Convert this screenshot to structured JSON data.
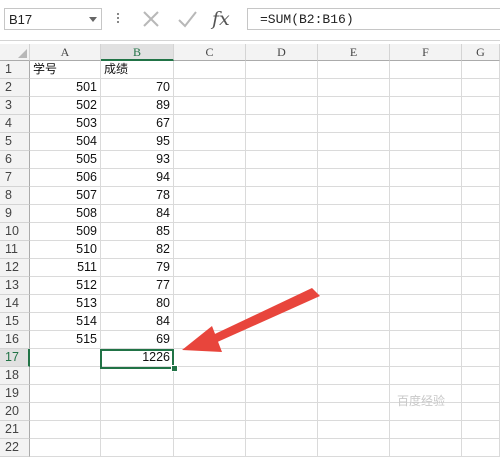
{
  "name_box": {
    "value": "B17"
  },
  "formula_bar": {
    "fx_label": "fx",
    "formula": "=SUM(B2:B16)"
  },
  "columns": [
    "A",
    "B",
    "C",
    "D",
    "E",
    "F",
    "G"
  ],
  "row_numbers": [
    "1",
    "2",
    "3",
    "4",
    "5",
    "6",
    "7",
    "8",
    "9",
    "10",
    "11",
    "12",
    "13",
    "14",
    "15",
    "16",
    "17",
    "18",
    "19",
    "20",
    "21",
    "22"
  ],
  "header_row": {
    "a": "学号",
    "b": "成绩"
  },
  "rows": [
    {
      "a": "501",
      "b": "70"
    },
    {
      "a": "502",
      "b": "89"
    },
    {
      "a": "503",
      "b": "67"
    },
    {
      "a": "504",
      "b": "95"
    },
    {
      "a": "505",
      "b": "93"
    },
    {
      "a": "506",
      "b": "94"
    },
    {
      "a": "507",
      "b": "78"
    },
    {
      "a": "508",
      "b": "84"
    },
    {
      "a": "509",
      "b": "85"
    },
    {
      "a": "510",
      "b": "82"
    },
    {
      "a": "511",
      "b": "79"
    },
    {
      "a": "512",
      "b": "77"
    },
    {
      "a": "513",
      "b": "80"
    },
    {
      "a": "514",
      "b": "84"
    },
    {
      "a": "515",
      "b": "69"
    }
  ],
  "total": "1226",
  "selected_cell": {
    "column": "B",
    "row": "17"
  },
  "watermark": "百度经验",
  "colors": {
    "accent": "#217346",
    "annotation_arrow": "#e8453c"
  }
}
